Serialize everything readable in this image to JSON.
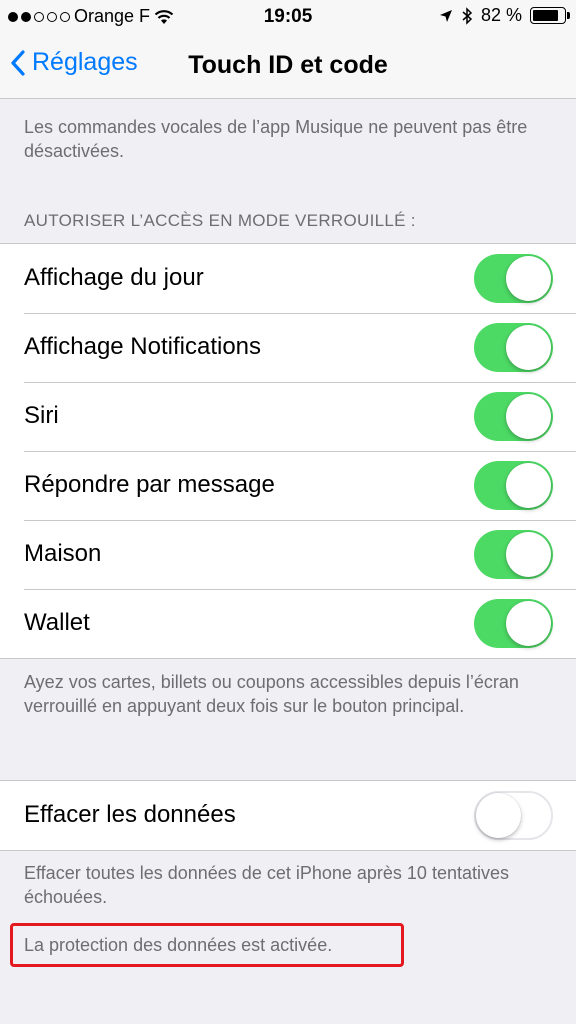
{
  "status_bar": {
    "carrier": "Orange F",
    "time": "19:05",
    "battery": "82 %",
    "battery_level": 0.82,
    "signal_bars": 2
  },
  "nav": {
    "back_label": "Réglages",
    "title": "Touch ID et code"
  },
  "notes": {
    "music": "Les commandes vocales de l’app Musique ne peuvent pas être désactivées.",
    "wallet": "Ayez vos cartes, billets ou coupons accessibles depuis l’écran verrouillé en appuyant deux fois sur le bouton principal.",
    "erase": "Effacer toutes les données de cet iPhone après 10 tentatives échouées.",
    "protection": "La protection des données est activée."
  },
  "locked_access": {
    "header": "AUTORISER L’ACCÈS EN MODE VERROUILLÉ :",
    "items": [
      {
        "label": "Affichage du jour",
        "on": true
      },
      {
        "label": "Affichage Notifications",
        "on": true
      },
      {
        "label": "Siri",
        "on": true
      },
      {
        "label": "Répondre par message",
        "on": true
      },
      {
        "label": "Maison",
        "on": true
      },
      {
        "label": "Wallet",
        "on": true
      }
    ]
  },
  "erase_data": {
    "label": "Effacer les données",
    "on": false
  },
  "colors": {
    "accent": "#007aff",
    "toggle_on": "#4cd964",
    "highlight": "#e3191f"
  }
}
